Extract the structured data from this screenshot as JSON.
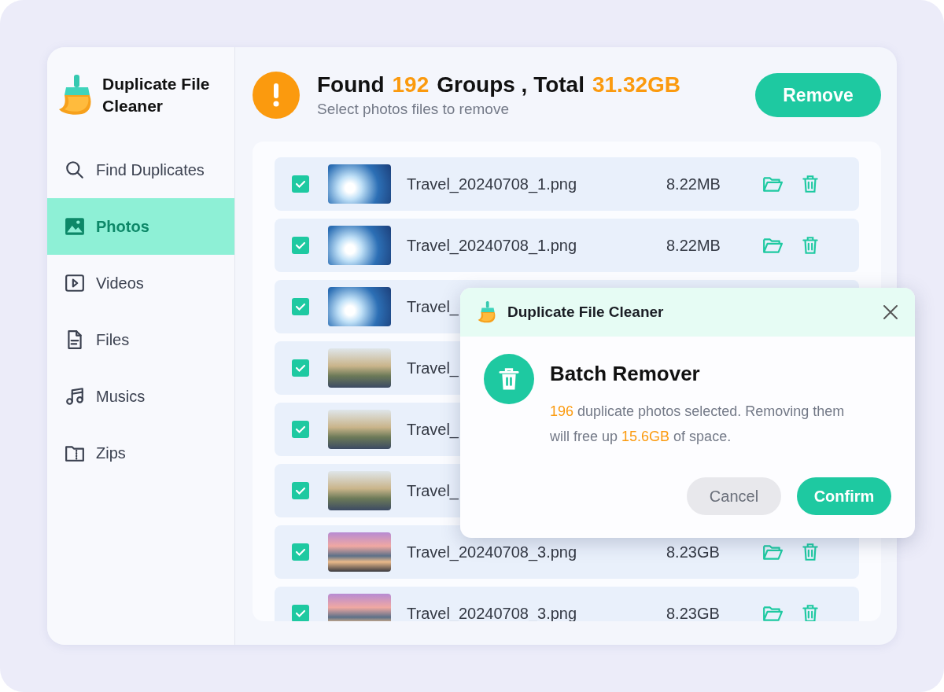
{
  "app": {
    "title": "Duplicate File Cleaner"
  },
  "sidebar": {
    "items": [
      {
        "label": "Find Duplicates",
        "kind": "search",
        "selected": false
      },
      {
        "label": "Photos",
        "kind": "image",
        "selected": true
      },
      {
        "label": "Videos",
        "kind": "video",
        "selected": false
      },
      {
        "label": "Files",
        "kind": "file",
        "selected": false
      },
      {
        "label": "Musics",
        "kind": "music",
        "selected": false
      },
      {
        "label": "Zips",
        "kind": "zip",
        "selected": false
      }
    ]
  },
  "header": {
    "found_label": "Found",
    "groups_count": "192",
    "groups_label": "Groups , Total",
    "total_size": "31.32GB",
    "subtitle": "Select photos files to remove",
    "remove_button": "Remove"
  },
  "rows": [
    {
      "name": "Travel_20240708_1.png",
      "size": "8.22MB",
      "checked": true,
      "kind": "sky"
    },
    {
      "name": "Travel_20240708_1.png",
      "size": "8.22MB",
      "checked": true,
      "kind": "sky"
    },
    {
      "name": "Travel_",
      "checked": true,
      "kind": "sky"
    },
    {
      "name": "Travel_",
      "checked": true,
      "kind": "street"
    },
    {
      "name": "Travel_",
      "checked": true,
      "kind": "street"
    },
    {
      "name": "Travel_",
      "checked": true,
      "kind": "street"
    },
    {
      "name": "Travel_20240708_3.png",
      "size": "8.23GB",
      "checked": true,
      "kind": "lake"
    },
    {
      "name": "Travel_20240708_3.png",
      "size": "8.23GB",
      "checked": true,
      "kind": "lake"
    }
  ],
  "dialog": {
    "title": "Duplicate File Cleaner",
    "heading": "Batch Remover",
    "message": "**196** duplicate photos selected. Removing them will free up **15.6GB** of space.",
    "buttons": [
      {
        "label": "Cancel",
        "kind": "secondary"
      },
      {
        "label": "Confirm",
        "kind": "primary"
      }
    ]
  }
}
